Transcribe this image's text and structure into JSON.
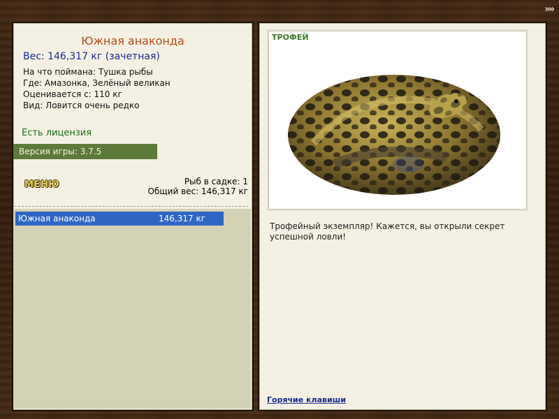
{
  "nav": {
    "arrows": "»»"
  },
  "fish": {
    "name": "Южная анаконда",
    "weight_line": "Вес: 146,317 кг (зачетная)",
    "caught_on": "На что поймана: Тушка рыбы",
    "location": "Где: Амазонка, Зелёный великан",
    "rated_from": "Оценивается с: 110 кг",
    "rarity": "Вид: Ловится очень редко"
  },
  "license": "Есть лицензия",
  "version": "Версия игры: 3.7.5",
  "menu_label": "МЕНЮ",
  "keepnet": {
    "count_line": "Рыб в садке: 1",
    "total_line": "Общий вес: 146,317 кг",
    "items": [
      {
        "name": "Южная анаконда",
        "weight": "146,317 кг"
      }
    ]
  },
  "trophy": {
    "label": "ТРОФЕЙ",
    "description": "Трофейный экземпляр! Кажется, вы открыли секрет успешной ловли!"
  },
  "hotkeys_label": "Горячие клавиши",
  "colors": {
    "title": "#b54a17",
    "weight": "#1a2a8a",
    "license": "#1c6a1c",
    "version_bar": "#5e7a3a",
    "selected_row": "#2f66c3"
  }
}
